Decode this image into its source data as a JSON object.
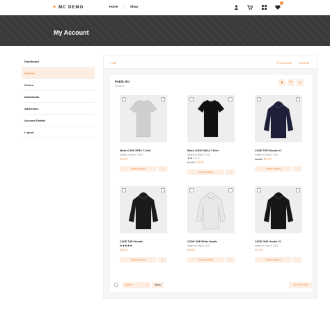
{
  "header": {
    "logo_text": "MC DEMO",
    "nav": [
      {
        "label": "Home"
      },
      {
        "label": "Shop"
      }
    ],
    "icons": [
      "user-icon",
      "cart-icon",
      "grid-icon",
      "heart-icon"
    ],
    "wishlist_count": "0"
  },
  "banner": {
    "title": "My Account"
  },
  "sidebar": {
    "items": [
      {
        "label": "Dashboard"
      },
      {
        "label": "Wishlist"
      },
      {
        "label": "Orders"
      },
      {
        "label": "Downloads"
      },
      {
        "label": "Addresses"
      },
      {
        "label": "Account Details"
      },
      {
        "label": "Logout"
      }
    ],
    "active_index": 1
  },
  "topbar": {
    "edit": "← Edit",
    "prev": "Previous list",
    "next": "Next list"
  },
  "list": {
    "title": "Public list",
    "owner": "by admin"
  },
  "products": [
    {
      "name": "White CODE ZERO T-Shirt",
      "added": "Added on: May 8, 2023",
      "old_price": "",
      "price": "$14.95",
      "stars": "",
      "button": "Select options",
      "more": "⋮",
      "color": "#cfcfcf",
      "type": "tshirt"
    },
    {
      "name": "Black CODE NINJA T-Shirt",
      "added": "Added on: May 8, 2023",
      "old_price": "$14.95",
      "price": "$12.95",
      "stars": "★★☆☆☆",
      "button": "Select options",
      "more": "⋮",
      "color": "#111111",
      "type": "tshirt"
    },
    {
      "name": "CODE TWO Hoodie V2",
      "added": "Added on: May 8, 2023",
      "old_price": "$14.95",
      "price": "$12.95",
      "stars": "",
      "button": "Select options",
      "more": "⋮",
      "color": "#1d2038",
      "type": "hoodie"
    },
    {
      "name": "CODE TWO Hoodie",
      "added": "",
      "old_price": "",
      "price": "$49.95",
      "stars": "★★★★★",
      "button": "Select options",
      "more": "⋮",
      "color": "#1a1a1a",
      "type": "hoodie"
    },
    {
      "name": "CODE ONE White Hoodie",
      "added": "Added on: May 8, 2023",
      "old_price": "",
      "price": "$29.95",
      "stars": "",
      "button": "Select options",
      "more": "⋮",
      "color": "#e8e8e8",
      "type": "hoodie"
    },
    {
      "name": "CODE ONE Hoodie V2",
      "added": "Added on: May 8, 2023",
      "old_price": "",
      "price": "$12.95",
      "stars": "",
      "button": "Select options",
      "more": "⋮",
      "color": "#161616",
      "type": "hoodie"
    }
  ],
  "bottom": {
    "actions_label": "Actions",
    "apply_label": "Apply",
    "add_all_label": "Add all to cart"
  },
  "colors": {
    "accent": "#f08a3c",
    "accent_bg": "#fdeee4",
    "banner": "#3a3a3a"
  }
}
